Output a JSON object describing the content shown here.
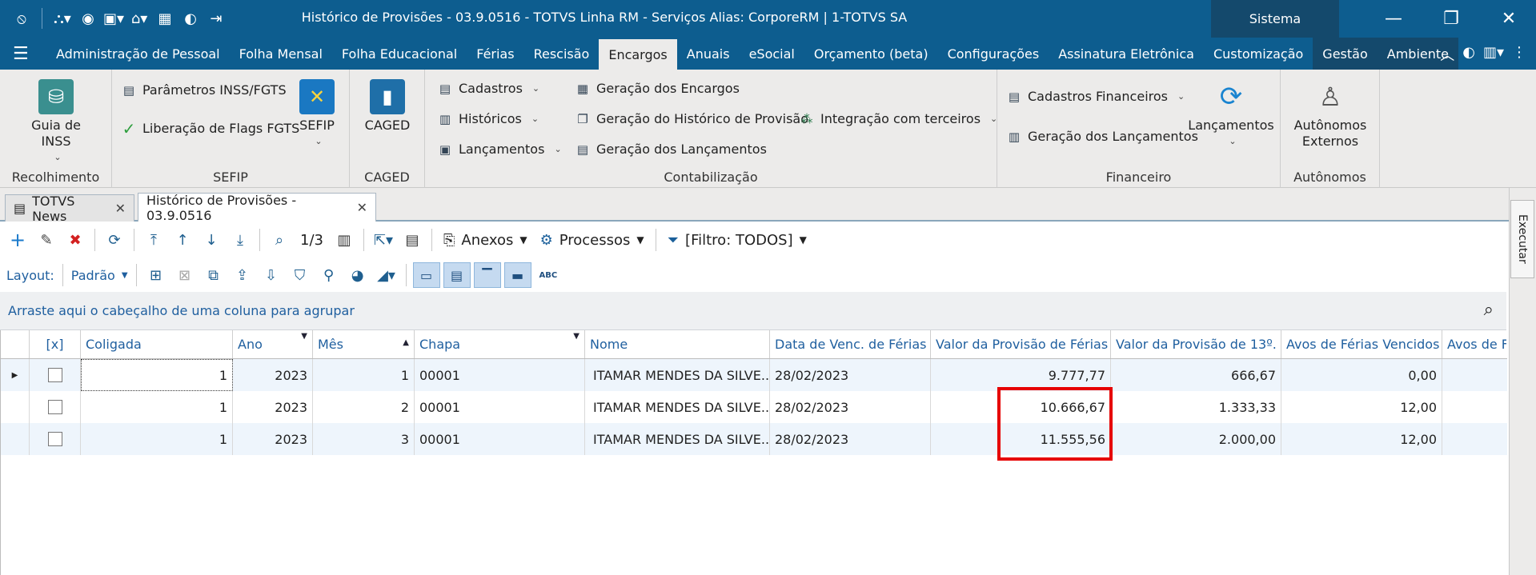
{
  "window": {
    "title": "Histórico de Provisões - 03.9.0516 - TOTVS Linha RM - Serviços  Alias: CorporeRM | 1-TOTVS SA",
    "system_label": "Sistema"
  },
  "menu": {
    "items": [
      "Administração de Pessoal",
      "Folha Mensal",
      "Folha Educacional",
      "Férias",
      "Rescisão",
      "Encargos",
      "Anuais",
      "eSocial",
      "Orçamento (beta)",
      "Configurações",
      "Assinatura Eletrônica",
      "Customização",
      "Gestão",
      "Ambiente"
    ],
    "active": "Encargos"
  },
  "ribbon": {
    "recolhimento": {
      "label": "Recolhimento",
      "guia_inss": "Guia de INSS"
    },
    "sefip": {
      "label": "SEFIP",
      "parametros": "Parâmetros INSS/FGTS",
      "liberacao": "Liberação de Flags FGTS",
      "sefip_btn": "SEFIP"
    },
    "caged": {
      "label": "CAGED",
      "caged_btn": "CAGED"
    },
    "contabilizacao": {
      "label": "Contabilização",
      "cadastros": "Cadastros",
      "historicos": "Históricos",
      "lancamentos": "Lançamentos",
      "geracao_encargos": "Geração dos Encargos",
      "geracao_historico": "Geração do Histórico de Provisão",
      "geracao_lancamentos": "Geração dos Lançamentos",
      "integracao": "Integração com terceiros"
    },
    "financeiro": {
      "label": "Financeiro",
      "cadastros_fin": "Cadastros Financeiros",
      "geracao_lanc": "Geração dos Lançamentos",
      "lancamentos": "Lançamentos"
    },
    "autonomos": {
      "label": "Autônomos",
      "externos": "Autônomos Externos"
    }
  },
  "tabs": [
    {
      "label": "TOTVS News"
    },
    {
      "label": "Histórico de Provisões - 03.9.0516"
    }
  ],
  "side_panel": {
    "executar": "Executar"
  },
  "toolbar": {
    "page": "1/3",
    "anexos": "Anexos",
    "processos": "Processos",
    "filtro": "[Filtro: TODOS]",
    "layout_label": "Layout:",
    "layout_value": "Padrão",
    "abc": "ABC"
  },
  "group_panel": {
    "hint": "Arraste aqui o cabeçalho de uma coluna para agrupar"
  },
  "grid": {
    "columns": [
      "[x]",
      "Coligada",
      "Ano",
      "Mês",
      "Chapa",
      "Nome",
      "Data de Venc. de Férias",
      "Valor da Provisão de Férias",
      "Valor da Provisão de 13º.",
      "Avos de Férias Vencidos",
      "Avos de Fe"
    ],
    "rows": [
      {
        "coligada": "1",
        "ano": "2023",
        "mes": "1",
        "chapa": "00001",
        "nome": "ITAMAR MENDES DA SILVE...",
        "data": "28/02/2023",
        "ferias": "9.777,77",
        "decimo": "666,67",
        "avos": "0,00"
      },
      {
        "coligada": "1",
        "ano": "2023",
        "mes": "2",
        "chapa": "00001",
        "nome": "ITAMAR MENDES DA SILVE...",
        "data": "28/02/2023",
        "ferias": "10.666,67",
        "decimo": "1.333,33",
        "avos": "12,00"
      },
      {
        "coligada": "1",
        "ano": "2023",
        "mes": "3",
        "chapa": "00001",
        "nome": "ITAMAR MENDES DA SILVE...",
        "data": "28/02/2023",
        "ferias": "11.555,56",
        "decimo": "2.000,00",
        "avos": "12,00"
      }
    ]
  },
  "colors": {
    "title_bar": "#0d5d8f",
    "highlight": "#e60000"
  }
}
